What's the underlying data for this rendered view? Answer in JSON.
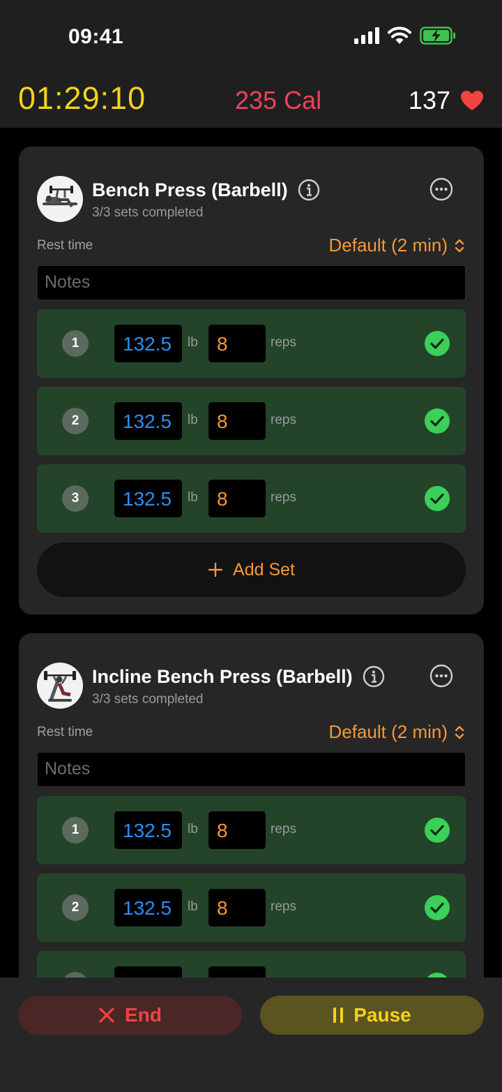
{
  "status_bar": {
    "time": "09:41"
  },
  "stats": {
    "elapsed": "01:29:10",
    "calories": "235 Cal",
    "heart_rate": "137"
  },
  "exercises": [
    {
      "title": "Bench Press (Barbell)",
      "subtitle": "3/3 sets completed",
      "rest_label": "Rest time",
      "rest_value": "Default (2 min)",
      "notes_placeholder": "Notes",
      "sets": [
        {
          "num": "1",
          "weight": "132.5",
          "unit": "lb",
          "reps": "8",
          "reps_label": "reps",
          "completed": true
        },
        {
          "num": "2",
          "weight": "132.5",
          "unit": "lb",
          "reps": "8",
          "reps_label": "reps",
          "completed": true
        },
        {
          "num": "3",
          "weight": "132.5",
          "unit": "lb",
          "reps": "8",
          "reps_label": "reps",
          "completed": true
        }
      ],
      "add_set_label": "Add Set"
    },
    {
      "title": "Incline Bench Press (Barbell)",
      "subtitle": "3/3 sets completed",
      "rest_label": "Rest time",
      "rest_value": "Default (2 min)",
      "notes_placeholder": "Notes",
      "sets": [
        {
          "num": "1",
          "weight": "132.5",
          "unit": "lb",
          "reps": "8",
          "reps_label": "reps",
          "completed": true
        },
        {
          "num": "2",
          "weight": "132.5",
          "unit": "lb",
          "reps": "8",
          "reps_label": "reps",
          "completed": true
        }
      ]
    }
  ],
  "actions": {
    "end_label": "End",
    "pause_label": "Pause"
  },
  "colors": {
    "timer": "#f4d21a",
    "calories": "#f0415a",
    "accent": "#f5983a",
    "weight": "#2b8ef0",
    "set_row": "#234429",
    "check": "#3ccf5a"
  },
  "icons": {
    "signal": "signal-icon",
    "wifi": "wifi-icon",
    "battery": "battery-charging-icon",
    "heart": "heart-icon",
    "info": "info-icon",
    "more": "more-icon",
    "check": "checkmark-icon",
    "plus": "plus-icon",
    "close": "close-icon",
    "pause": "pause-icon",
    "chevron": "chevron-up-down-icon"
  }
}
